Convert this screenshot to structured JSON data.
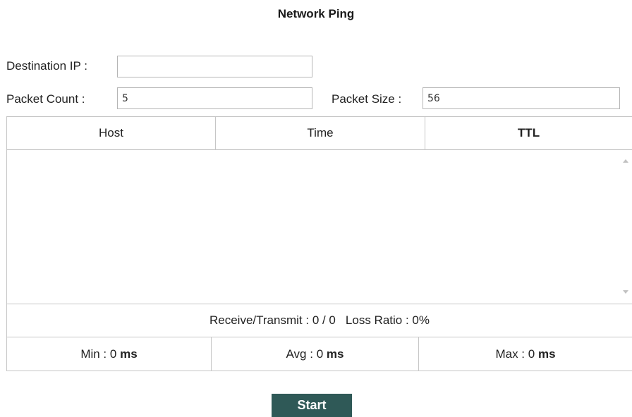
{
  "page": {
    "title": "Network Ping"
  },
  "form": {
    "destination_ip": {
      "label": "Destination IP :",
      "value": ""
    },
    "packet_count": {
      "label": "Packet Count :",
      "value": "5"
    },
    "packet_size": {
      "label": "Packet Size :",
      "value": "56"
    }
  },
  "results_table": {
    "columns": [
      "Host",
      "Time",
      "TTL"
    ],
    "rows": []
  },
  "summary": {
    "receive_transmit_label": "Receive/Transmit :",
    "receive_transmit_value": "0 / 0",
    "loss_ratio_label": "Loss Ratio :",
    "loss_ratio_value": "0%"
  },
  "stats": {
    "min_label": "Min :",
    "min_value": "0",
    "avg_label": "Avg :",
    "avg_value": "0",
    "max_label": "Max :",
    "max_value": "0",
    "unit": "ms"
  },
  "actions": {
    "start_label": "Start"
  },
  "colors": {
    "button_bg": "#2f5957",
    "border": "#c6c6c6"
  }
}
